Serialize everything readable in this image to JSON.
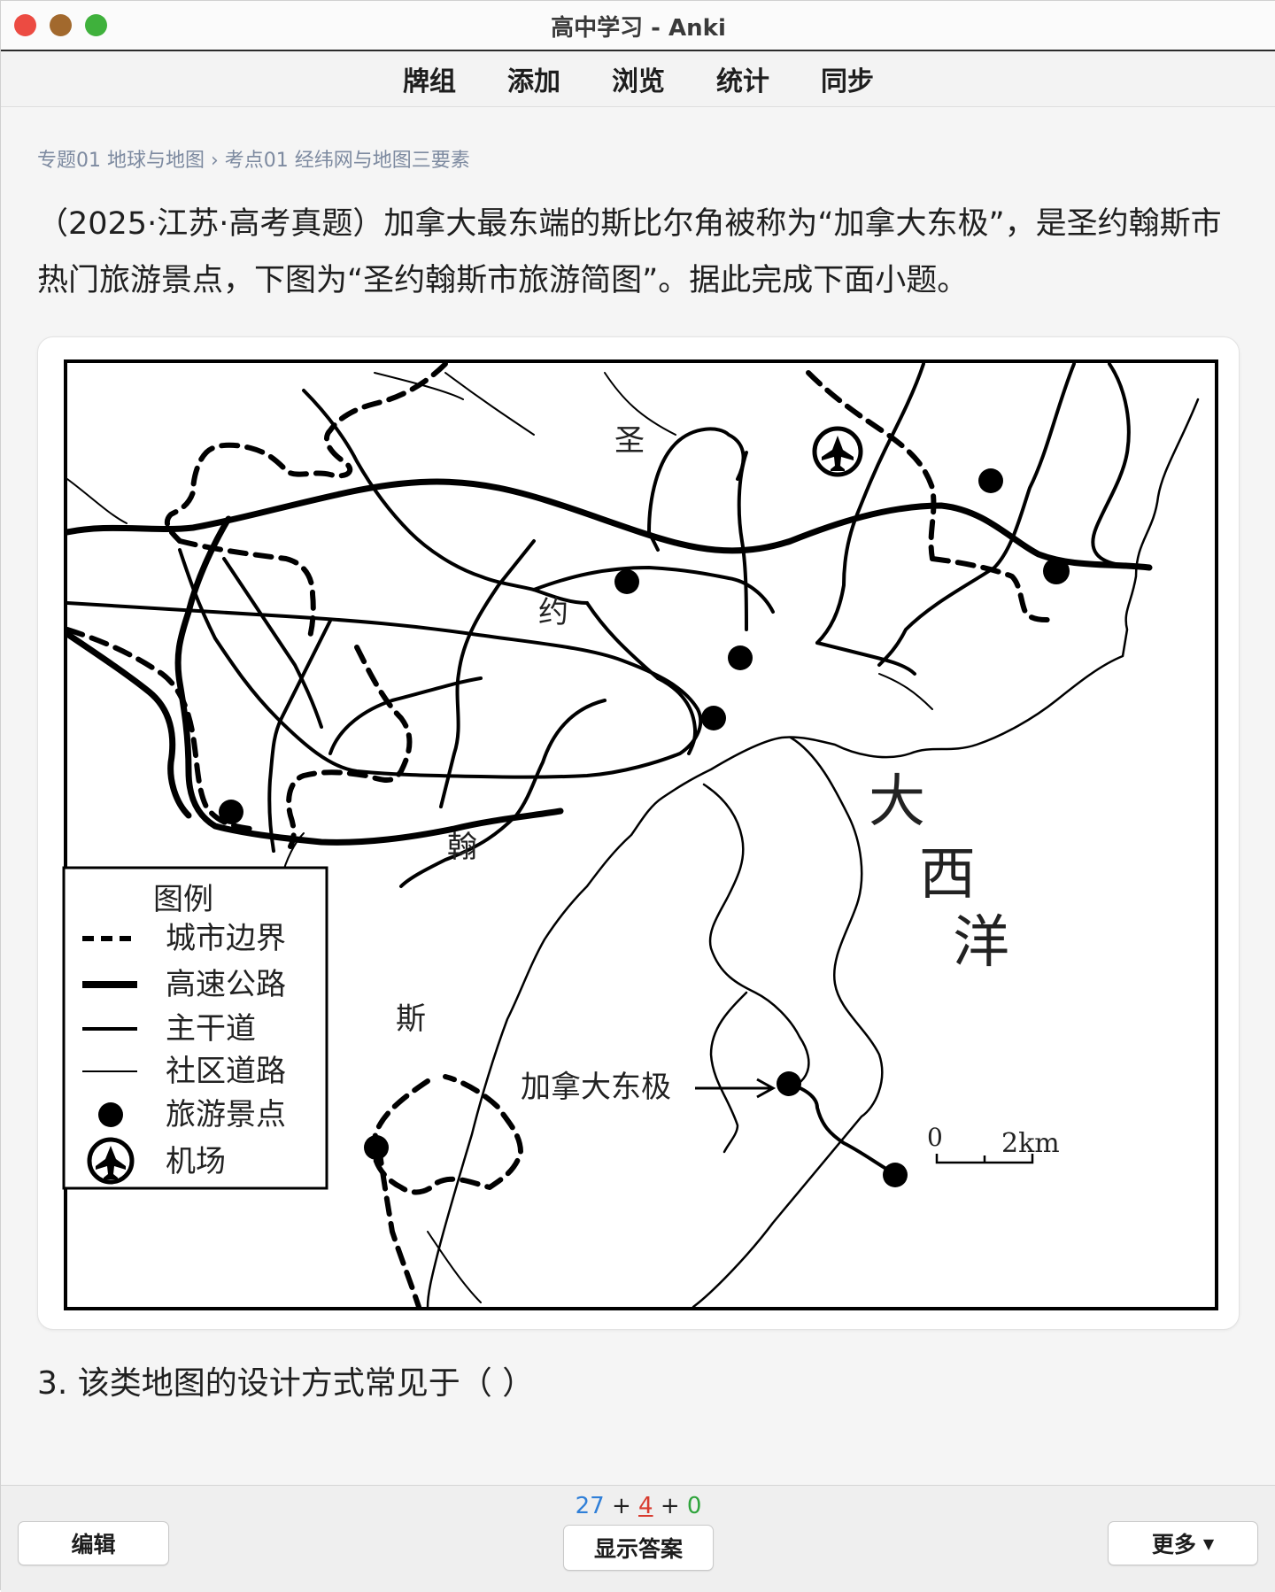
{
  "window": {
    "title": "高中学习 - Anki"
  },
  "toolbar": {
    "items": [
      "牌组",
      "添加",
      "浏览",
      "统计",
      "同步"
    ]
  },
  "breadcrumb": "专题01 地球与地图 › 考点01 经纬网与地图三要素",
  "question": "（2025·江苏·高考真题）加拿大最东端的斯比尔角被称为“加拿大东极”，是圣约翰斯市热门旅游景点，下图为“圣约翰斯市旅游简图”。据此完成下面小题。",
  "map": {
    "city_chars": [
      "圣",
      "约",
      "翰",
      "斯"
    ],
    "ocean_chars": [
      "大",
      "西",
      "洋"
    ],
    "legend_title": "图例",
    "legend_items": [
      "城市边界",
      "高速公路",
      "主干道",
      "社区道路",
      "旅游景点",
      "机场"
    ],
    "annotation": "加拿大东极",
    "scale_zero": "0",
    "scale_label": "2km"
  },
  "subquestion": "3.  该类地图的设计方式常见于（   ）",
  "bottom": {
    "count_new": "27",
    "count_learn": "4",
    "count_review": "0",
    "plus": "+",
    "edit_label": "编辑",
    "show_answer_label": "显示答案",
    "more_label": "更多"
  }
}
